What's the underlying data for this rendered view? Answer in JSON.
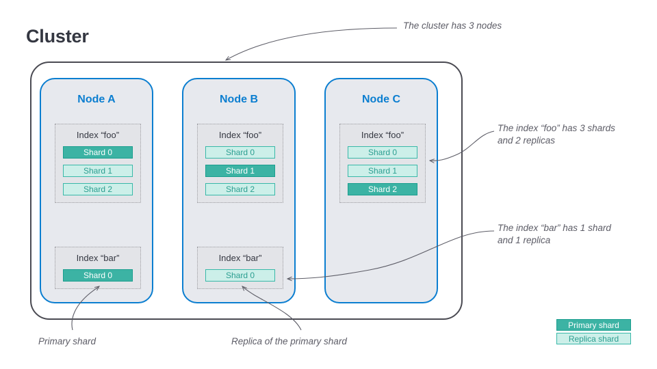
{
  "title": "Cluster",
  "cluster": {
    "nodes": [
      {
        "name": "Node A",
        "indices": [
          {
            "name": "Index “foo”",
            "shards": [
              {
                "label": "Shard 0",
                "type": "primary"
              },
              {
                "label": "Shard 1",
                "type": "replica"
              },
              {
                "label": "Shard 2",
                "type": "replica"
              }
            ]
          },
          {
            "name": "Index “bar”",
            "shards": [
              {
                "label": "Shard 0",
                "type": "primary"
              }
            ]
          }
        ]
      },
      {
        "name": "Node B",
        "indices": [
          {
            "name": "Index “foo”",
            "shards": [
              {
                "label": "Shard 0",
                "type": "replica"
              },
              {
                "label": "Shard 1",
                "type": "primary"
              },
              {
                "label": "Shard 2",
                "type": "replica"
              }
            ]
          },
          {
            "name": "Index “bar”",
            "shards": [
              {
                "label": "Shard 0",
                "type": "replica"
              }
            ]
          }
        ]
      },
      {
        "name": "Node C",
        "indices": [
          {
            "name": "Index “foo”",
            "shards": [
              {
                "label": "Shard 0",
                "type": "replica"
              },
              {
                "label": "Shard 1",
                "type": "replica"
              },
              {
                "label": "Shard 2",
                "type": "primary"
              }
            ]
          }
        ]
      }
    ]
  },
  "annotations": {
    "cluster_nodes": "The cluster has 3 nodes",
    "index_foo": "The index “foo” has 3 shards\nand 2 replicas",
    "index_bar": "The index “bar” has 1 shard\nand 1 replica",
    "primary_shard": "Primary shard",
    "replica_shard": "Replica of the primary shard"
  },
  "legend": {
    "primary": "Primary shard",
    "replica": "Replica shard"
  },
  "colors": {
    "title_text": "#343741",
    "node_border": "#0b7ed0",
    "node_fill": "#e7e9ee",
    "cluster_border": "#4a4a52",
    "index_fill": "#e3e4e8",
    "primary_fill": "#3cb3a4",
    "primary_text": "#ffffff",
    "replica_fill": "#ccefe9",
    "replica_text": "#2b9e90",
    "annotation_text": "#5c5c66",
    "leader_line": "#5c5c66"
  }
}
